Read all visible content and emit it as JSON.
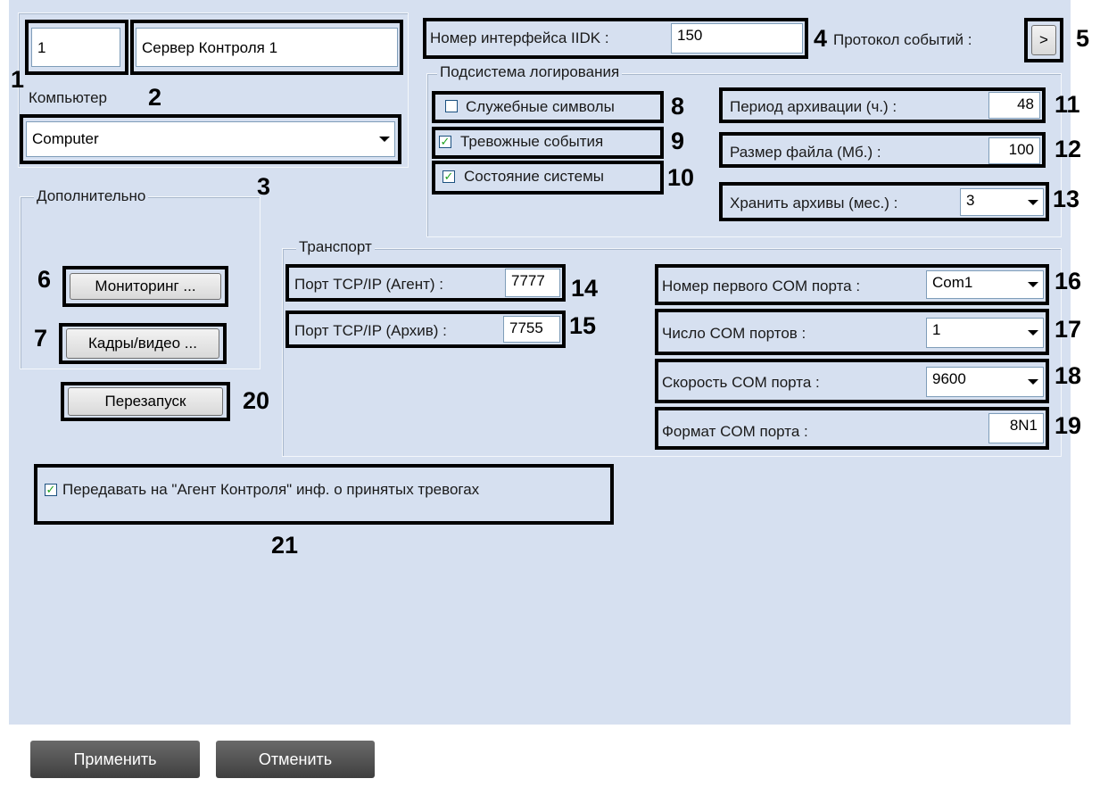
{
  "server": {
    "id_value": "1",
    "name_value": "Сервер Контроля 1",
    "computer_label": "Компьютер",
    "computer_value": "Computer"
  },
  "iidk": {
    "label": "Номер интерфейса IIDK :",
    "value": "150"
  },
  "event_protocol": {
    "label": "Протокол событий :",
    "button": ">"
  },
  "logging": {
    "title": "Подсистема логирования",
    "service_symbols": {
      "label": "Служебные символы",
      "checked": false
    },
    "alarm_events": {
      "label": "Тревожные события",
      "checked": true
    },
    "system_state": {
      "label": "Состояние системы",
      "checked": true
    },
    "archive_period": {
      "label": "Период архивации (ч.) :",
      "value": "48"
    },
    "file_size": {
      "label": "Размер файла (Мб.) :",
      "value": "100"
    },
    "keep_archives": {
      "label": "Хранить архивы (мес.) :",
      "value": "3"
    }
  },
  "additional": {
    "title": "Дополнительно",
    "monitoring_button": "Мониторинг ...",
    "frames_button": "Кадры/видео ..."
  },
  "restart_button": "Перезапуск",
  "transport": {
    "title": "Транспорт",
    "tcp_agent": {
      "label": "Порт TCP/IP (Агент) :",
      "value": "7777"
    },
    "tcp_archive": {
      "label": "Порт TCP/IP (Архив) :",
      "value": "7755"
    },
    "com_first": {
      "label": "Номер первого COM порта :",
      "value": "Com1"
    },
    "com_count": {
      "label": "Число COM портов :",
      "value": "1"
    },
    "com_speed": {
      "label": "Скорость COM порта :",
      "value": "9600"
    },
    "com_format": {
      "label": "Формат COM порта :",
      "value": "8N1"
    }
  },
  "send_alarms": {
    "label": "Передавать на \"Агент Контроля\" инф. о принятых тревогах",
    "checked": true
  },
  "callouts": [
    "1",
    "2",
    "3",
    "4",
    "5",
    "6",
    "7",
    "8",
    "9",
    "10",
    "11",
    "12",
    "13",
    "14",
    "15",
    "16",
    "17",
    "18",
    "19",
    "20",
    "21"
  ],
  "footer": {
    "apply": "Применить",
    "cancel": "Отменить"
  },
  "colors": {
    "panel_bg": "#d6e0f0",
    "highlight": "#000000",
    "check": "#21a121"
  }
}
